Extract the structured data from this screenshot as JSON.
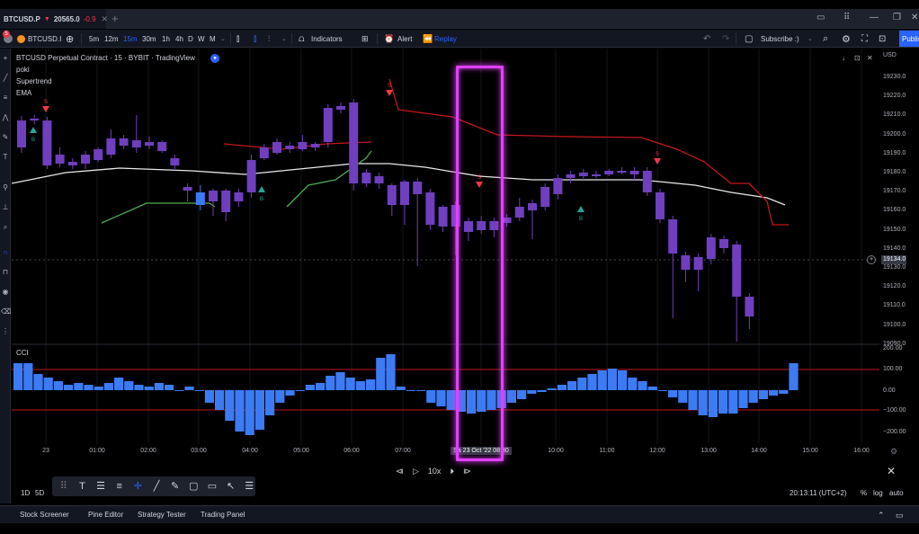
{
  "tab": {
    "symbol": "BTCUSD.P",
    "price": "20565.0",
    "change": "-0.9",
    "close": "✕",
    "new": "+"
  },
  "window": {
    "minimize": "—",
    "maximize": "❐",
    "close": "✕",
    "grid": "⠿"
  },
  "toolbar": {
    "symbol": "BTCUSD.I",
    "badge": "5",
    "intervals": [
      "5m",
      "12m",
      "15m",
      "30m",
      "1h",
      "4h",
      "D",
      "W",
      "M"
    ],
    "active_interval": "15m",
    "indicators": "Indicators",
    "alert": "Alert",
    "replay": "Replay",
    "subscribe": "Subscribe :)",
    "publish": "Publish"
  },
  "legend": {
    "title": "BTCUSD Perpetual Contract · 15 · BYBIT · TradingView",
    "ind1": "poki",
    "ind2": "Supertrend",
    "ind3": "EMA",
    "cci": "CCI"
  },
  "currency": "USD",
  "price_axis": [
    "19230.0",
    "19220.0",
    "19210.0",
    "19200.0",
    "19190.0",
    "19180.0",
    "19170.0",
    "19160.0",
    "19150.0",
    "19140.0",
    "19130.0",
    "19120.0",
    "19110.0",
    "19100.0",
    "19090.0"
  ],
  "current_price": "19134.0",
  "cci_axis": [
    "200.00",
    "100.00",
    "0.00",
    "−100.00",
    "−200.00"
  ],
  "time_axis": [
    "23",
    "01:00",
    "02:00",
    "03:00",
    "04:00",
    "05:00",
    "06:00",
    "07:00",
    "Sa 23 Oct '22  08:30",
    "10:00",
    "11:00",
    "12:00",
    "13:00",
    "14:00",
    "15:00",
    "16:00"
  ],
  "replay": {
    "speed": "10x"
  },
  "bottom": {
    "range1": "1D",
    "range2": "5D",
    "clock": "20:13:11 (UTC+2)",
    "pct": "%",
    "log": "log",
    "auto": "auto"
  },
  "panels": [
    "Stock Screener",
    "Pine Editor",
    "Strategy Tester",
    "Trading Panel"
  ],
  "signals": {
    "buy": "B",
    "sell": "S"
  },
  "colors": {
    "bull": "#3d7bf5",
    "bear": "#6f3fbf",
    "supertrend_down": "#c2181b",
    "supertrend_up": "#4caf50",
    "ema": "#e8e8e8",
    "cci": "#3d7bf5",
    "cci_level": "#c2181b",
    "highlight": "#e040fb",
    "accent": "#2962ff"
  }
}
